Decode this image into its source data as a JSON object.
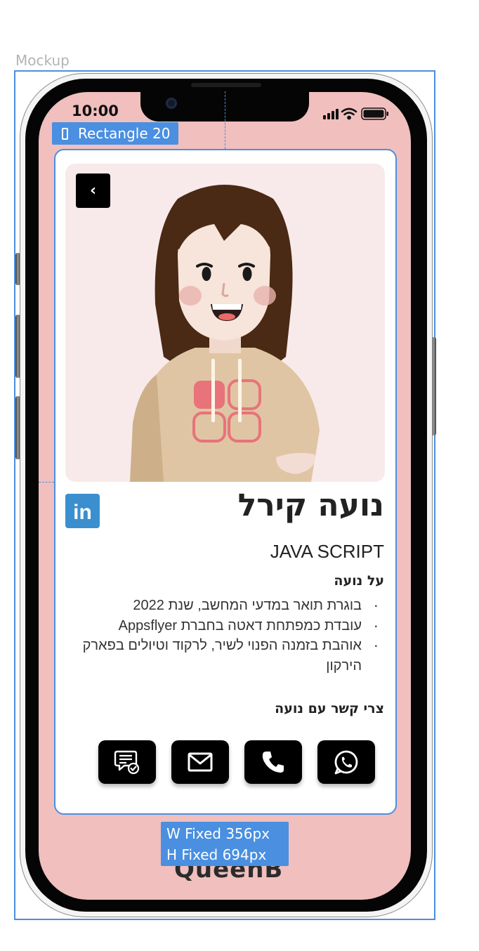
{
  "canvas": {
    "frame_label": "Mockup",
    "selection_label": "Rectangle 20",
    "width_label": "W Fixed 356px",
    "height_label": "H Fixed 694px"
  },
  "status_bar": {
    "time": "10:00"
  },
  "profile": {
    "name": "נועה קירל",
    "role": "JAVA SCRIPT",
    "about_title": "על נועה",
    "about_items": [
      "בוגרת תואר במדעי המחשב, שנת 2022",
      "עובדת כמפתחת דאטה בחברת Appsflyer",
      "אוהבת בזמנה הפנוי לשיר, לרקוד וטיולים בפארק הירקון"
    ],
    "contact_title": "צרי קשר עם נועה",
    "linkedin_label": "in",
    "back_label": "‹"
  },
  "contact_buttons": [
    "chat-icon",
    "mail-icon",
    "phone-icon",
    "whatsapp-icon"
  ],
  "brand": "QueenB",
  "colors": {
    "screen_bg": "#f0bfbe",
    "hero_bg": "#f8eaea",
    "selection": "#4a8fe0",
    "linkedin": "#3b8fcf"
  }
}
